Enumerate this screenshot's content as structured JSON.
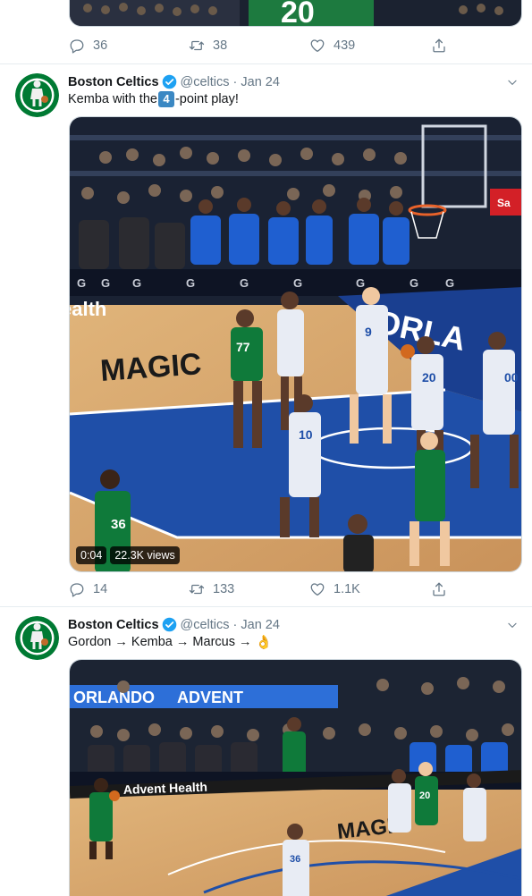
{
  "prev_tweet": {
    "jersey_text": "20",
    "replies": "36",
    "retweets": "38",
    "likes": "439"
  },
  "tweets": [
    {
      "name": "Boston Celtics",
      "handle": "@celtics",
      "dot": "·",
      "date": "Jan 24",
      "text_before": "Kemba with the ",
      "keycap": "4",
      "text_after": "-point play!",
      "video": {
        "time": "0:04",
        "views": "22.3K views",
        "court_text": "ORLA",
        "baseline_text": "ealth",
        "sponsor": "Sa",
        "jerseys": [
          "77",
          "10",
          "20",
          "9",
          "00",
          "36"
        ],
        "logo_text": "MAGIC"
      },
      "replies": "14",
      "retweets": "133",
      "likes": "1.1K"
    },
    {
      "name": "Boston Celtics",
      "handle": "@celtics",
      "dot": "·",
      "date": "Jan 24",
      "text": "Gordon → Kemba → Marcus →",
      "emoji": "👌",
      "video": {
        "banner": "ORLANDO",
        "banner2": "ADVENT",
        "court_text": "Advent Health",
        "jerseys": [
          "20",
          "36"
        ]
      }
    }
  ],
  "colors": {
    "celtics_green": "#007a33",
    "verified_blue": "#1da1f2",
    "court_wood": "#d9a86a",
    "court_blue": "#1f4fa8"
  },
  "icons": [
    "reply-icon",
    "retweet-icon",
    "like-icon",
    "share-icon",
    "verified-icon",
    "chevron-down-icon"
  ]
}
